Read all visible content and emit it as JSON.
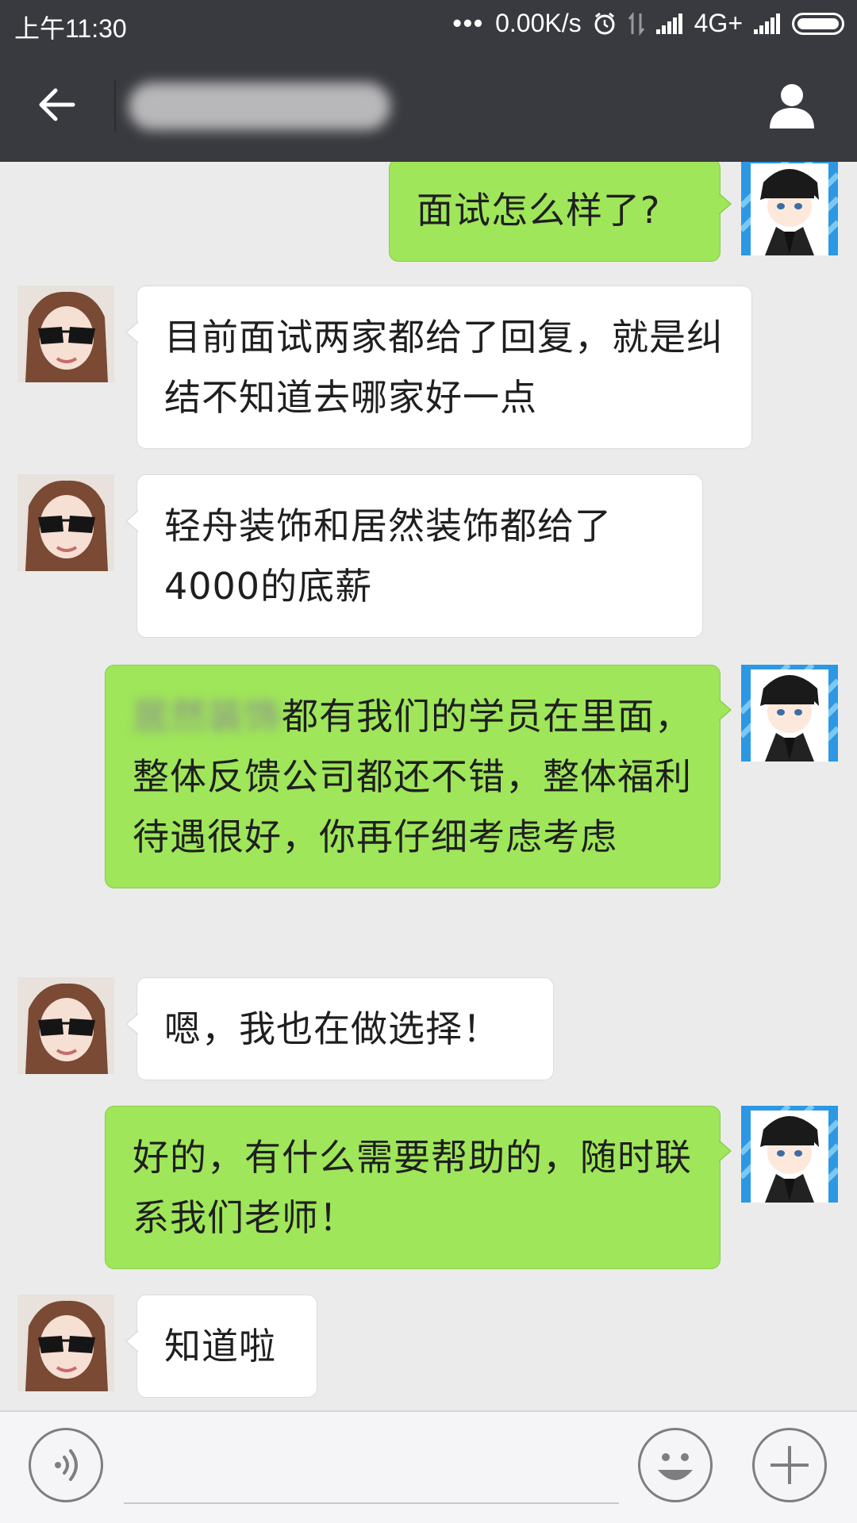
{
  "status_bar": {
    "time": "上午11:30",
    "dots": "•••",
    "net_speed": "0.00K/s",
    "network_type": "4G+",
    "icons": [
      "alarm-icon",
      "data-transfer-icon",
      "signal-icon",
      "battery-icon"
    ]
  },
  "header": {
    "title": "",
    "title_blurred": true,
    "icons": [
      "back-arrow-icon",
      "contact-profile-icon"
    ]
  },
  "messages": [
    {
      "from": "me",
      "text": "面试怎么样了?"
    },
    {
      "from": "contact",
      "text": "目前面试两家都给了回复，就是纠结不知道去哪家好一点"
    },
    {
      "from": "contact",
      "text": "轻舟装饰和居然装饰都给了4000的底薪"
    },
    {
      "from": "me",
      "text_blurred_prefix": "居然装饰",
      "text": "都有我们的学员在里面，整体反馈公司都还不错，整体福利待遇很好，你再仔细考虑考虑"
    },
    {
      "from": "contact",
      "text": "嗯，我也在做选择！"
    },
    {
      "from": "me",
      "text": "好的，有什么需要帮助的，随时联系我们老师！"
    },
    {
      "from": "contact",
      "text": "知道啦"
    }
  ],
  "input_bar": {
    "icons": [
      "voice-icon",
      "emoji-icon",
      "plus-icon"
    ]
  },
  "colors": {
    "bar_bg": "#393a3f",
    "chat_bg": "#ebebeb",
    "outgoing_bubble": "#9fe65a",
    "incoming_bubble": "#ffffff"
  }
}
